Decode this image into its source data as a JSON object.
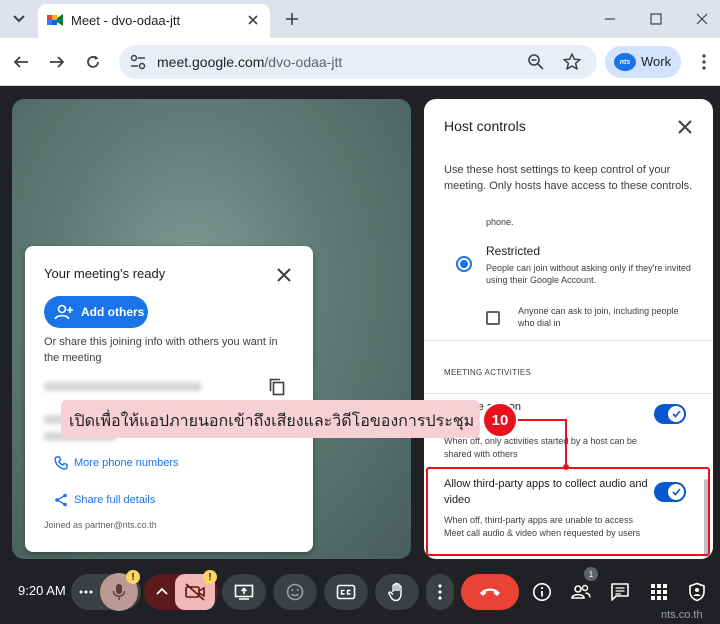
{
  "browser": {
    "tab_title": "Meet - dvo-odaa-jtt",
    "url_host": "meet.google.com",
    "url_path": "/dvo-odaa-jtt",
    "profile_label": "Work",
    "profile_logo": "nts"
  },
  "ready_card": {
    "title": "Your meeting's ready",
    "add_others_label": "Add others",
    "share_text": "Or share this joining info with others you want in the meeting",
    "more_phone_numbers": "More phone numbers",
    "share_full_details": "Share full details",
    "joined_as": "Joined as partner@nts.co.th"
  },
  "host_controls": {
    "title": "Host controls",
    "description": "Use these host settings to keep control of your meeting. Only hosts have access to these controls.",
    "cut_text": "phone.",
    "restricted_label": "Restricted",
    "restricted_desc": "People can join without asking only if they're invited using their Google Account.",
    "anyone_ask_label": "Anyone can ask to join, including people who dial in",
    "section_heading": "MEETING ACTIVITIES",
    "share_addon_label": "rs share add-on",
    "share_addon_desc": "When off, only activities started by a host can be shared with others",
    "third_party_label": "Allow third-party apps to collect audio and video",
    "third_party_desc": "When off, third-party apps are unable to access Meet call audio & video when requested by users",
    "restricted_selected": true,
    "anyone_ask_checked": false,
    "share_addon_on": true,
    "third_party_on": true
  },
  "annotation": {
    "text": "เปิดเพื่อให้แอปภายนอกเข้าถึงเสียงและวิดีโอของการประชุม",
    "step": "10"
  },
  "control_bar": {
    "time": "9:20 AM",
    "people_count": "1",
    "warn_glyph": "!"
  },
  "watermark": "nts.co.th",
  "colors": {
    "accent_blue": "#1a73e8",
    "toggle_blue": "#0b57d0",
    "end_call_red": "#ea4335",
    "annotation_red": "#e8121d",
    "annotation_fill": "#f7d0d6",
    "warning_yellow": "#fdd663"
  }
}
